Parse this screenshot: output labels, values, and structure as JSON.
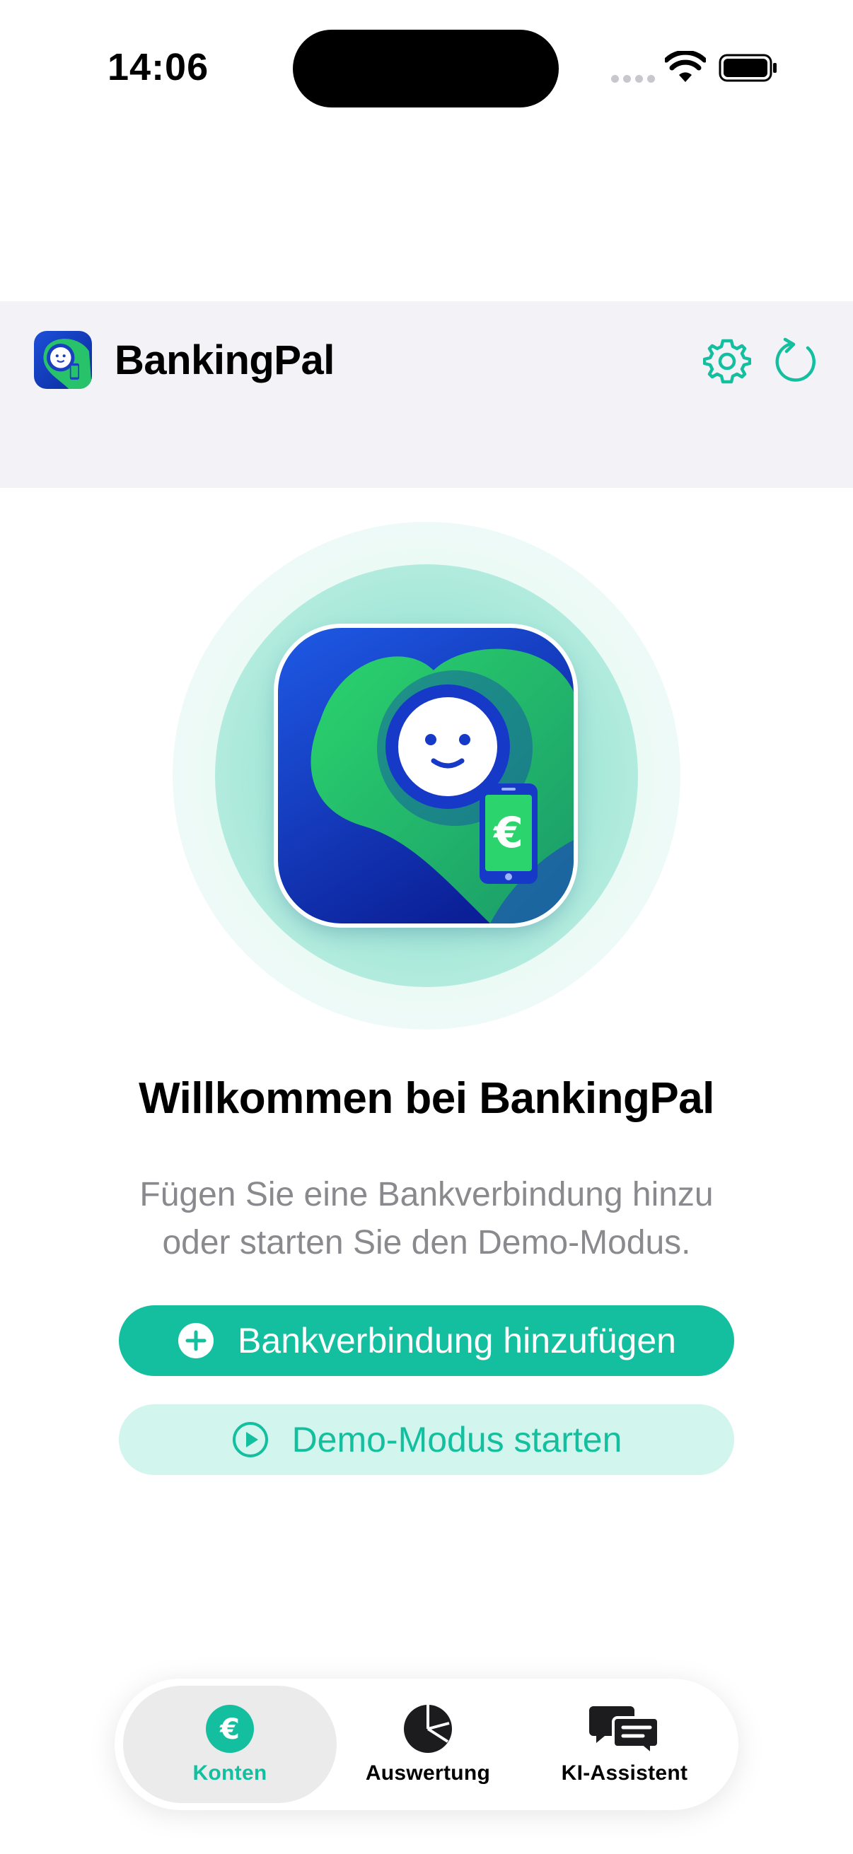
{
  "status_bar": {
    "time": "14:06"
  },
  "header": {
    "app_title": "BankingPal"
  },
  "welcome": {
    "title": "Willkommen bei BankingPal",
    "subtitle_line1": "Fügen Sie eine Bankverbindung hinzu",
    "subtitle_line2": "oder starten Sie den Demo-Modus."
  },
  "actions": {
    "add_bank_label": "Bankverbindung hinzufügen",
    "demo_label": "Demo-Modus starten"
  },
  "tabs": [
    {
      "label": "Konten",
      "icon": "euro-circle-icon",
      "active": true
    },
    {
      "label": "Auswertung",
      "icon": "pie-chart-icon",
      "active": false
    },
    {
      "label": "KI-Assistent",
      "icon": "chat-bubbles-icon",
      "active": false
    }
  ],
  "colors": {
    "accent": "#14bf9f",
    "accent_light": "#d2f5ed",
    "nav_background": "#f2f2f7",
    "brand_blue": "#1240c8",
    "brand_green": "#22c55e"
  }
}
